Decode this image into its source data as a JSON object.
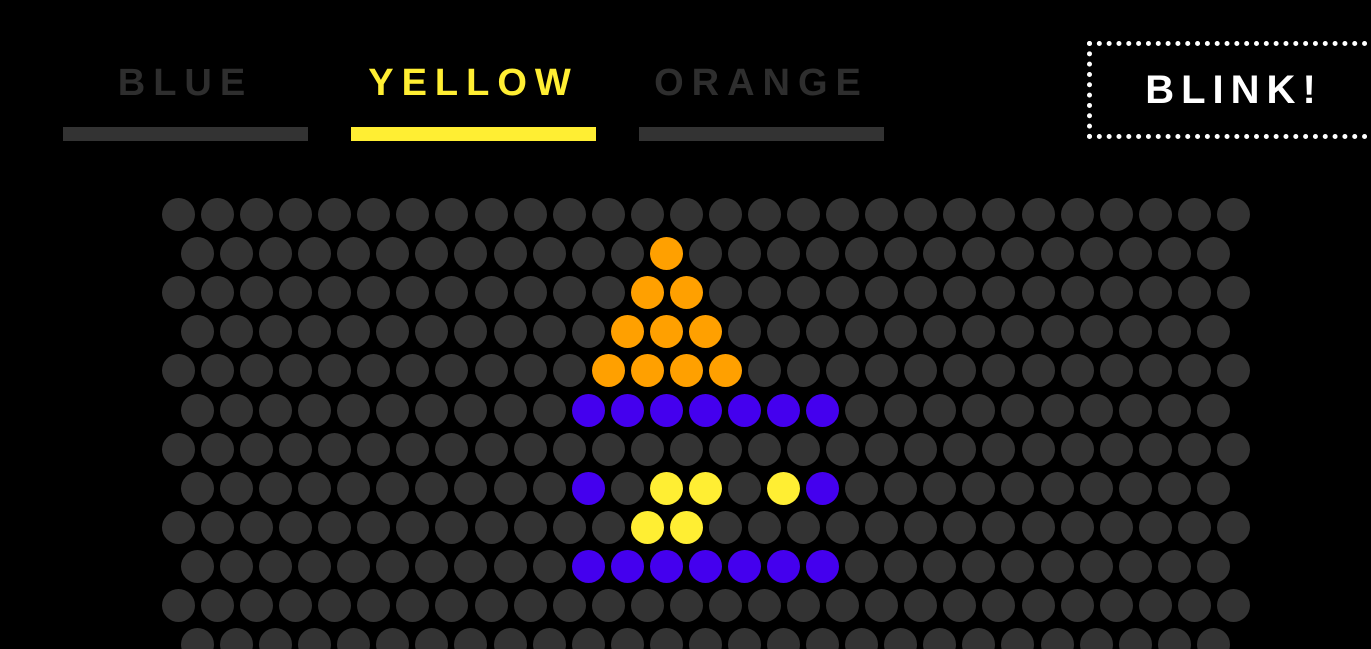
{
  "tabs": [
    {
      "label": "BLUE",
      "selected": false
    },
    {
      "label": "YELLOW",
      "selected": true
    },
    {
      "label": "ORANGE",
      "selected": false
    }
  ],
  "blink_button": {
    "label": "BLINK!"
  },
  "colors": {
    "background": "#000000",
    "off": "#333333",
    "tab_inactive_text": "#2e2e2e",
    "tab_inactive_bar": "#333333",
    "tab_active": "#ffee33",
    "blue": "#4400ee",
    "yellow": "#ffee33",
    "orange": "#ffa000"
  },
  "grid": {
    "rows_visible": 12,
    "rows": [
      "............................",
      "............O..............",
      "............OO..............",
      "...........OOO.............",
      "...........OOOO.............",
      "..........BBBBBBB..........",
      "............................",
      "..........B.YY.YB..........",
      "............YY..............",
      "..........BBBBBBB..........",
      "............................",
      "..........................."
    ]
  }
}
